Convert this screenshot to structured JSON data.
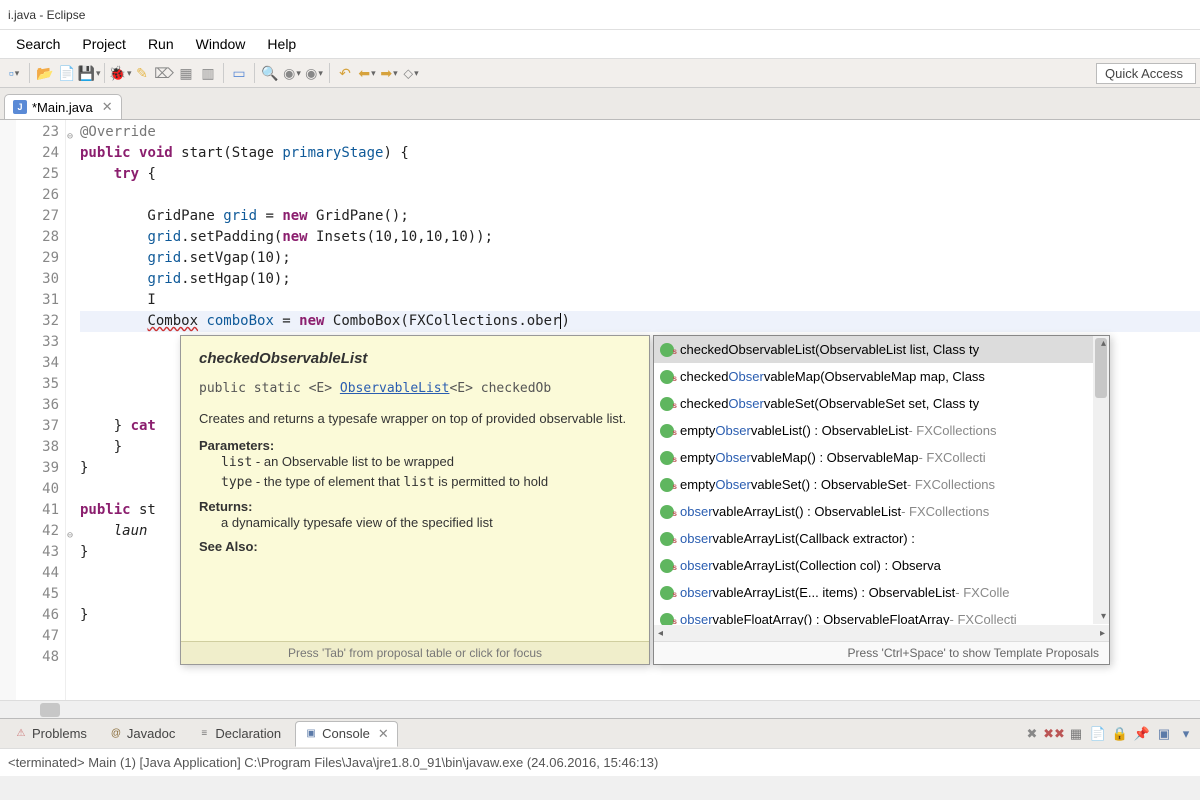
{
  "title": "i.java - Eclipse",
  "menu": [
    "Search",
    "Project",
    "Run",
    "Window",
    "Help"
  ],
  "quick_access": "Quick Access",
  "editor_tab": {
    "name": "*Main.java"
  },
  "gutter": [
    {
      "n": "23",
      "fold": true
    },
    {
      "n": "24",
      "warn": true
    },
    {
      "n": "25"
    },
    {
      "n": "26"
    },
    {
      "n": "27"
    },
    {
      "n": "28"
    },
    {
      "n": "29"
    },
    {
      "n": "30"
    },
    {
      "n": "31"
    },
    {
      "n": "32",
      "err": true
    },
    {
      "n": "33"
    },
    {
      "n": "34"
    },
    {
      "n": "35"
    },
    {
      "n": "36"
    },
    {
      "n": "37"
    },
    {
      "n": "38"
    },
    {
      "n": "39"
    },
    {
      "n": "40"
    },
    {
      "n": "41"
    },
    {
      "n": "42",
      "fold": true
    },
    {
      "n": "43"
    },
    {
      "n": "44"
    },
    {
      "n": "45"
    },
    {
      "n": "46"
    },
    {
      "n": "47"
    },
    {
      "n": "48"
    }
  ],
  "code": {
    "l23": "@Override",
    "l24_a": "public",
    "l24_b": "void",
    "l24_c": " start(Stage ",
    "l24_d": "primaryStage",
    "l24_e": ") {",
    "l25_a": "try",
    "l25_b": " {",
    "l27_a": "GridPane ",
    "l27_b": "grid",
    "l27_c": " = ",
    "l27_d": "new",
    "l27_e": " GridPane();",
    "l28_a": "grid",
    "l28_b": ".setPadding(",
    "l28_c": "new",
    "l28_d": " Insets(10,10,10,10));",
    "l29_a": "grid",
    "l29_b": ".setVgap(10);",
    "l30_a": "grid",
    "l30_b": ".setHgap(10);",
    "l32_a": "Combox",
    "l32_b": " comboBox",
    "l32_c": " = ",
    "l32_d": "new",
    "l32_e": " ComboBox(FXCollections.ober",
    "l32_f": ")",
    "l37_a": "} ",
    "l37_b": "cat",
    "l38": "    }",
    "l39": "}",
    "l42_a": "public",
    "l42_b": " st",
    "l43_a": "laun",
    "l44": "}",
    "l47": "}"
  },
  "doc": {
    "title": "checkedObservableList",
    "sig_pre": "public static <E> ",
    "sig_link": "ObservableList",
    "sig_post": "<E> checkedOb",
    "desc": "Creates and returns a typesafe wrapper on top of provided observable list.",
    "sect_params": "Parameters:",
    "p1_name": "list",
    "p1_desc": " - an Observable list to be wrapped",
    "p2_name": "type",
    "p2_desc_a": " - the type of element that ",
    "p2_code": "list",
    "p2_desc_b": " is permitted to hold",
    "sect_returns": "Returns:",
    "ret": "a dynamically typesafe view of the specified list",
    "sect_see": "See Also:",
    "footer": "Press 'Tab' from proposal table or click for focus"
  },
  "proposals": [
    {
      "pre": "checkedObservableList(ObservableList<E> list, Class<E> ty",
      "match": "",
      "sel": true
    },
    {
      "pre": "checked",
      "match": "Obser",
      "post": "vableMap(ObservableMap<K,V> map, Class"
    },
    {
      "pre": "checked",
      "match": "Obser",
      "post": "vableSet(ObservableSet<E> set, Class<E> ty"
    },
    {
      "pre": "empty",
      "match": "Obser",
      "post": "vableList() : ObservableList<E>",
      "ret": " - FXCollections"
    },
    {
      "pre": "empty",
      "match": "Obser",
      "post": "vableMap() : ObservableMap<K,V>",
      "ret": " - FXCollecti"
    },
    {
      "pre": "empty",
      "match": "Obser",
      "post": "vableSet() : ObservableSet<E>",
      "ret": " - FXCollections"
    },
    {
      "pre": "",
      "match": "obser",
      "post": "vableArrayList() : ObservableList<E>",
      "ret": " - FXCollections"
    },
    {
      "pre": "",
      "match": "obser",
      "post": "vableArrayList(Callback<E,Observable[]> extractor) : "
    },
    {
      "pre": "",
      "match": "obser",
      "post": "vableArrayList(Collection<? extends E> col) : Observa"
    },
    {
      "pre": "",
      "match": "obser",
      "post": "vableArrayList(E... items) : ObservableList<E>",
      "ret": " - FXColle"
    },
    {
      "pre": "",
      "match": "obser",
      "post": "vableFloatArray() : ObservableFloatArray",
      "ret": " - FXCollecti"
    }
  ],
  "proposals_footer": "Press 'Ctrl+Space' to show Template Proposals",
  "bottom_tabs": [
    {
      "label": "Problems",
      "ico": "⚠",
      "color": "#c77"
    },
    {
      "label": "Javadoc",
      "ico": "@",
      "color": "#8a6d3b"
    },
    {
      "label": "Declaration",
      "ico": "≡",
      "color": "#777"
    },
    {
      "label": "Console",
      "ico": "▣",
      "color": "#5b7aa8",
      "active": true
    }
  ],
  "console": "<terminated> Main (1) [Java Application] C:\\Program Files\\Java\\jre1.8.0_91\\bin\\javaw.exe (24.06.2016, 15:46:13)"
}
